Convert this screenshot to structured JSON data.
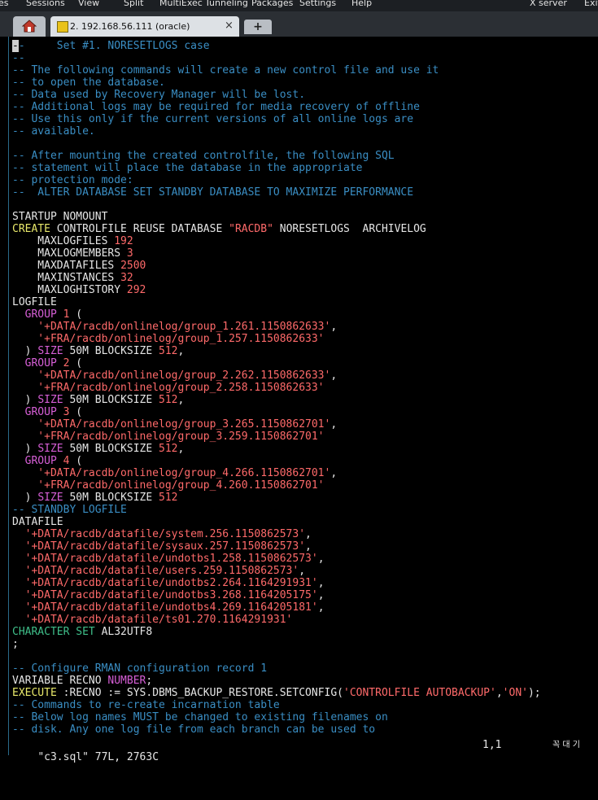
{
  "menu": [
    "es",
    "Sessions",
    "View",
    "Split",
    "MultiExec",
    "Tunneling",
    "Packages",
    "Settings",
    "Help",
    "X server",
    "Exit"
  ],
  "tab": {
    "label": "2. 192.168.56.111 (oracle)",
    "close": "×",
    "new": "+"
  },
  "editor": {
    "lines": [
      [
        [
          "c",
          "-"
        ],
        [
          "c",
          "-     Set #1. NORESETLOGS case"
        ]
      ],
      [
        [
          "c",
          "--"
        ]
      ],
      [
        [
          "c",
          "-- The following commands will create a new control file and use it"
        ]
      ],
      [
        [
          "c",
          "-- to open the database."
        ]
      ],
      [
        [
          "c",
          "-- Data used by Recovery Manager will be lost."
        ]
      ],
      [
        [
          "c",
          "-- Additional logs may be required for media recovery of offline"
        ]
      ],
      [
        [
          "c",
          "-- Use this only if the current versions of all online logs are"
        ]
      ],
      [
        [
          "c",
          "-- available."
        ]
      ],
      [],
      [
        [
          "c",
          "-- After mounting the created controlfile, the following SQL"
        ]
      ],
      [
        [
          "c",
          "-- statement will place the database in the appropriate"
        ]
      ],
      [
        [
          "c",
          "-- protection mode:"
        ]
      ],
      [
        [
          "c",
          "--  ALTER DATABASE SET STANDBY DATABASE TO MAXIMIZE PERFORMANCE"
        ]
      ],
      [],
      [
        [
          "t",
          "STARTUP NOMOUNT"
        ]
      ],
      [
        [
          "y",
          "CREATE"
        ],
        [
          "t",
          " CONTROLFILE REUSE DATABASE "
        ],
        [
          "s",
          "\"RACDB\""
        ],
        [
          "t",
          " NORESETLOGS  ARCHIVELOG"
        ]
      ],
      [
        [
          "t",
          "    MAXLOGFILES "
        ],
        [
          "n",
          "192"
        ]
      ],
      [
        [
          "t",
          "    MAXLOGMEMBERS "
        ],
        [
          "n",
          "3"
        ]
      ],
      [
        [
          "t",
          "    MAXDATAFILES "
        ],
        [
          "n",
          "2500"
        ]
      ],
      [
        [
          "t",
          "    MAXINSTANCES "
        ],
        [
          "n",
          "32"
        ]
      ],
      [
        [
          "t",
          "    MAXLOGHISTORY "
        ],
        [
          "n",
          "292"
        ]
      ],
      [
        [
          "t",
          "LOGFILE"
        ]
      ],
      [
        [
          "k",
          "  GROUP "
        ],
        [
          "n",
          "1"
        ],
        [
          "t",
          " ("
        ]
      ],
      [
        [
          "s",
          "    '+DATA/racdb/onlinelog/group_1.261.1150862633'"
        ],
        [
          "t",
          ","
        ]
      ],
      [
        [
          "s",
          "    '+FRA/racdb/onlinelog/group_1.257.1150862633'"
        ]
      ],
      [
        [
          "t",
          "  ) "
        ],
        [
          "k",
          "SIZE"
        ],
        [
          "t",
          " 50M BLOCKSIZE "
        ],
        [
          "n",
          "512"
        ],
        [
          "t",
          ","
        ]
      ],
      [
        [
          "k",
          "  GROUP "
        ],
        [
          "n",
          "2"
        ],
        [
          "t",
          " ("
        ]
      ],
      [
        [
          "s",
          "    '+DATA/racdb/onlinelog/group_2.262.1150862633'"
        ],
        [
          "t",
          ","
        ]
      ],
      [
        [
          "s",
          "    '+FRA/racdb/onlinelog/group_2.258.1150862633'"
        ]
      ],
      [
        [
          "t",
          "  ) "
        ],
        [
          "k",
          "SIZE"
        ],
        [
          "t",
          " 50M BLOCKSIZE "
        ],
        [
          "n",
          "512"
        ],
        [
          "t",
          ","
        ]
      ],
      [
        [
          "k",
          "  GROUP "
        ],
        [
          "n",
          "3"
        ],
        [
          "t",
          " ("
        ]
      ],
      [
        [
          "s",
          "    '+DATA/racdb/onlinelog/group_3.265.1150862701'"
        ],
        [
          "t",
          ","
        ]
      ],
      [
        [
          "s",
          "    '+FRA/racdb/onlinelog/group_3.259.1150862701'"
        ]
      ],
      [
        [
          "t",
          "  ) "
        ],
        [
          "k",
          "SIZE"
        ],
        [
          "t",
          " 50M BLOCKSIZE "
        ],
        [
          "n",
          "512"
        ],
        [
          "t",
          ","
        ]
      ],
      [
        [
          "k",
          "  GROUP "
        ],
        [
          "n",
          "4"
        ],
        [
          "t",
          " ("
        ]
      ],
      [
        [
          "s",
          "    '+DATA/racdb/onlinelog/group_4.266.1150862701'"
        ],
        [
          "t",
          ","
        ]
      ],
      [
        [
          "s",
          "    '+FRA/racdb/onlinelog/group_4.260.1150862701'"
        ]
      ],
      [
        [
          "t",
          "  ) "
        ],
        [
          "k",
          "SIZE"
        ],
        [
          "t",
          " 50M BLOCKSIZE "
        ],
        [
          "n",
          "512"
        ]
      ],
      [
        [
          "c",
          "-- STANDBY LOGFILE"
        ]
      ],
      [
        [
          "t",
          "DATAFILE"
        ]
      ],
      [
        [
          "s",
          "  '+DATA/racdb/datafile/system.256.1150862573'"
        ],
        [
          "t",
          ","
        ]
      ],
      [
        [
          "s",
          "  '+DATA/racdb/datafile/sysaux.257.1150862573'"
        ],
        [
          "t",
          ","
        ]
      ],
      [
        [
          "s",
          "  '+DATA/racdb/datafile/undotbs1.258.1150862573'"
        ],
        [
          "t",
          ","
        ]
      ],
      [
        [
          "s",
          "  '+DATA/racdb/datafile/users.259.1150862573'"
        ],
        [
          "t",
          ","
        ]
      ],
      [
        [
          "s",
          "  '+DATA/racdb/datafile/undotbs2.264.1164291931'"
        ],
        [
          "t",
          ","
        ]
      ],
      [
        [
          "s",
          "  '+DATA/racdb/datafile/undotbs3.268.1164205175'"
        ],
        [
          "t",
          ","
        ]
      ],
      [
        [
          "s",
          "  '+DATA/racdb/datafile/undotbs4.269.1164205181'"
        ],
        [
          "t",
          ","
        ]
      ],
      [
        [
          "s",
          "  '+DATA/racdb/datafile/ts01.270.1164291931'"
        ]
      ],
      [
        [
          "g",
          "CHARACTER SET"
        ],
        [
          "t",
          " AL32UTF8"
        ]
      ],
      [
        [
          "t",
          ";"
        ]
      ],
      [],
      [
        [
          "c",
          "-- Configure RMAN configuration record 1"
        ]
      ],
      [
        [
          "t",
          "VARIABLE RECNO "
        ],
        [
          "k",
          "NUMBER"
        ],
        [
          "t",
          ";"
        ]
      ],
      [
        [
          "y",
          "EXECUTE"
        ],
        [
          "t",
          " :RECNO := SYS.DBMS_BACKUP_RESTORE.SETCONFIG("
        ],
        [
          "s",
          "'CONTROLFILE AUTOBACKUP'"
        ],
        [
          "t",
          ","
        ],
        [
          "s",
          "'ON'"
        ],
        [
          "t",
          ");"
        ]
      ],
      [
        [
          "c",
          "-- Commands to re-create incarnation table"
        ]
      ],
      [
        [
          "c",
          "-- Below log names MUST be changed to existing filenames on"
        ]
      ],
      [
        [
          "c",
          "-- disk. Any one log file from each branch can be used to"
        ]
      ]
    ]
  },
  "status": {
    "file": "\"c3.sql\" 77L, 2763C",
    "position": "1,1",
    "ime": "꼭 대 기"
  }
}
